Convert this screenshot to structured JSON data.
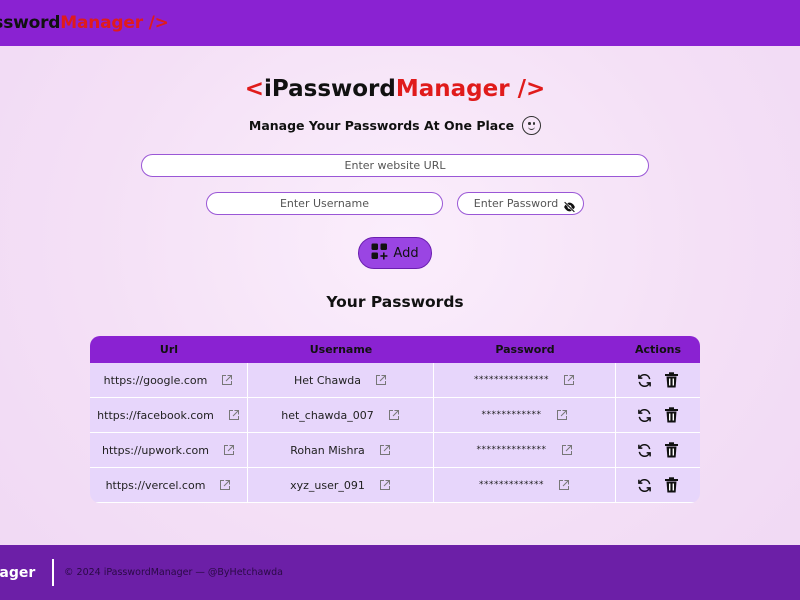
{
  "navbar": {
    "logo_left": "asswordManager",
    "logo_split_black": "asswordM",
    "logo_black": "assword",
    "logo_red": "Manager />"
  },
  "hero": {
    "open": "<",
    "brand_black": "iPassword",
    "brand_red": "Manager",
    "close": " />",
    "subtitle": "Manage Your Passwords At One Place"
  },
  "form": {
    "url_placeholder": "Enter website URL",
    "username_placeholder": "Enter Username",
    "password_placeholder": "Enter Password",
    "add_label": "Add"
  },
  "section_title": "Your Passwords",
  "table": {
    "headers": [
      "Url",
      "Username",
      "Password",
      "Actions"
    ],
    "rows": [
      {
        "url": "https://google.com",
        "username": "Het Chawda",
        "password": "***************"
      },
      {
        "url": "https://facebook.com",
        "username": "het_chawda_007",
        "password": "************"
      },
      {
        "url": "https://upwork.com",
        "username": "Rohan Mishra",
        "password": "**************"
      },
      {
        "url": "https://vercel.com",
        "username": "xyz_user_091",
        "password": "*************"
      }
    ]
  },
  "footer": {
    "logo": "anager",
    "copyright": "© 2024 iPasswordManager — @ByHetchawda"
  },
  "colors": {
    "navbar": "#8a22d2",
    "accent_red": "#e01b1b",
    "button": "#9a45e3",
    "row_bg": "#e7d6fb",
    "footer": "#6c1fa7"
  },
  "icons": {
    "subtitle": "smiley-face-icon",
    "password_toggle": "eye-slash-icon",
    "add": "add-grid-icon",
    "open_link": "external-link-icon",
    "edit": "refresh-icon",
    "delete": "trash-icon"
  }
}
